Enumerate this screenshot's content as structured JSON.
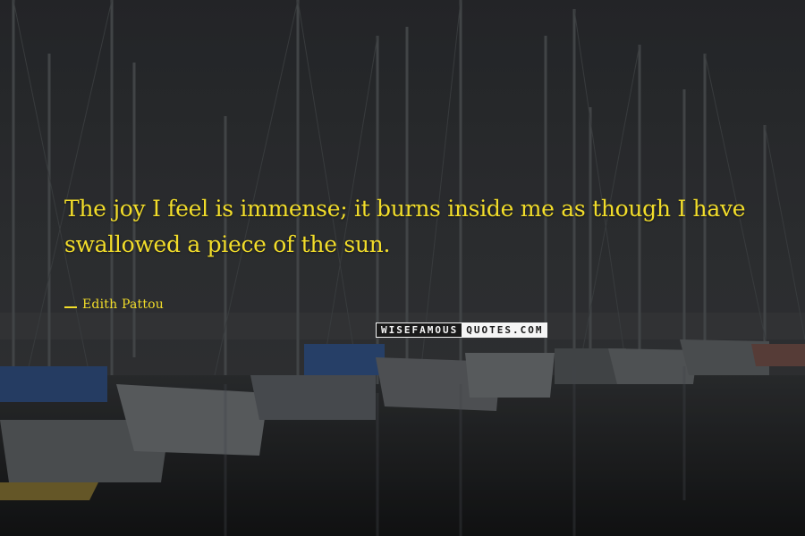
{
  "quote": {
    "text": "The joy I feel is immense; it burns inside me as though I have swallowed a piece of the sun.",
    "author": "Edith Pattou"
  },
  "watermark": {
    "left": "WISEFAMOUS",
    "right": "QUOTES.COM"
  },
  "scene": {
    "description_icon": "harbor-sailboats-photo",
    "colors": {
      "sky": "#2f3135",
      "water": "#1c1e20",
      "quote": "#f2dd2a"
    }
  }
}
